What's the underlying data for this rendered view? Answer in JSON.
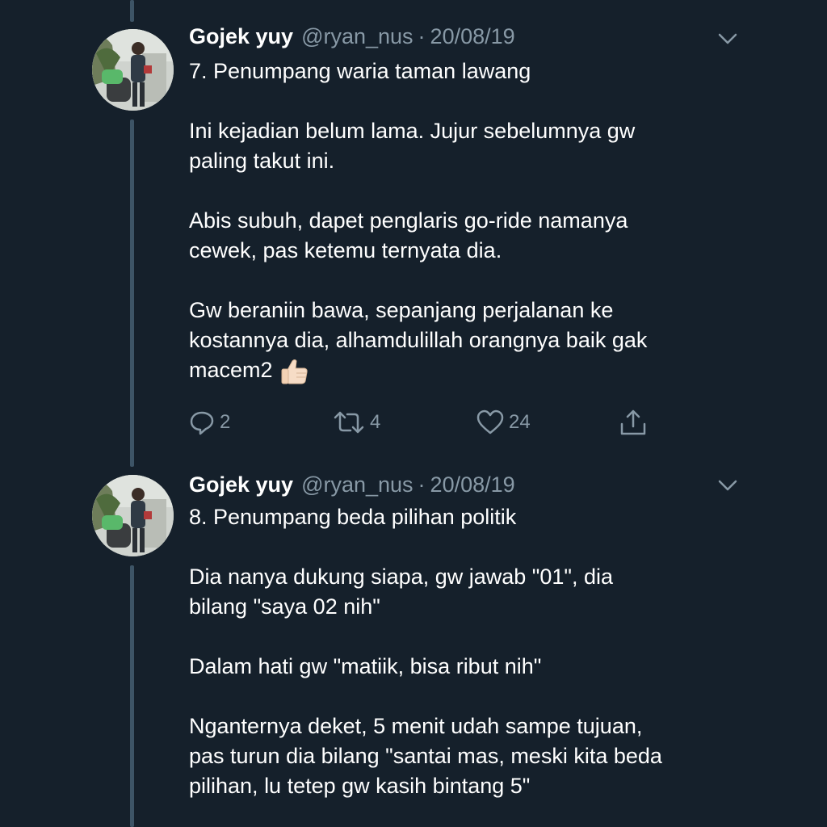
{
  "tweets": [
    {
      "display_name": "Gojek yuy",
      "handle": "@ryan_nus",
      "separator": "·",
      "date": "20/08/19",
      "body": [
        "7. Penumpang waria taman lawang",
        "",
        "Ini kejadian belum lama. Jujur sebelumnya gw",
        "paling takut ini.",
        "",
        "Abis subuh, dapet penglaris go-ride namanya",
        "cewek, pas ketemu ternyata dia.",
        "",
        "Gw beraniin bawa, sepanjang perjalanan ke",
        "kostannya dia, alhamdulillah orangnya baik gak",
        "macem2"
      ],
      "emoji": "thumbs-up-icon",
      "actions": {
        "reply_count": "2",
        "retweet_count": "4",
        "like_count": "24",
        "share_icon": "share-icon"
      }
    },
    {
      "display_name": "Gojek yuy",
      "handle": "@ryan_nus",
      "separator": "·",
      "date": "20/08/19",
      "body": [
        "8. Penumpang beda pilihan politik",
        "",
        "Dia nanya dukung siapa, gw jawab \"01\", dia",
        "bilang \"saya 02 nih\"",
        "",
        "Dalam hati gw \"matiik, bisa ribut nih\"",
        "",
        "Nganternya deket, 5 menit udah sampe tujuan,",
        "pas turun dia bilang \"santai mas, meski kita beda",
        "pilihan, lu tetep gw kasih bintang 5\""
      ]
    }
  ],
  "colors": {
    "background": "#15202b",
    "thread_line": "#3d5466",
    "secondary_text": "#8899a6",
    "primary_text": "#ffffff"
  }
}
